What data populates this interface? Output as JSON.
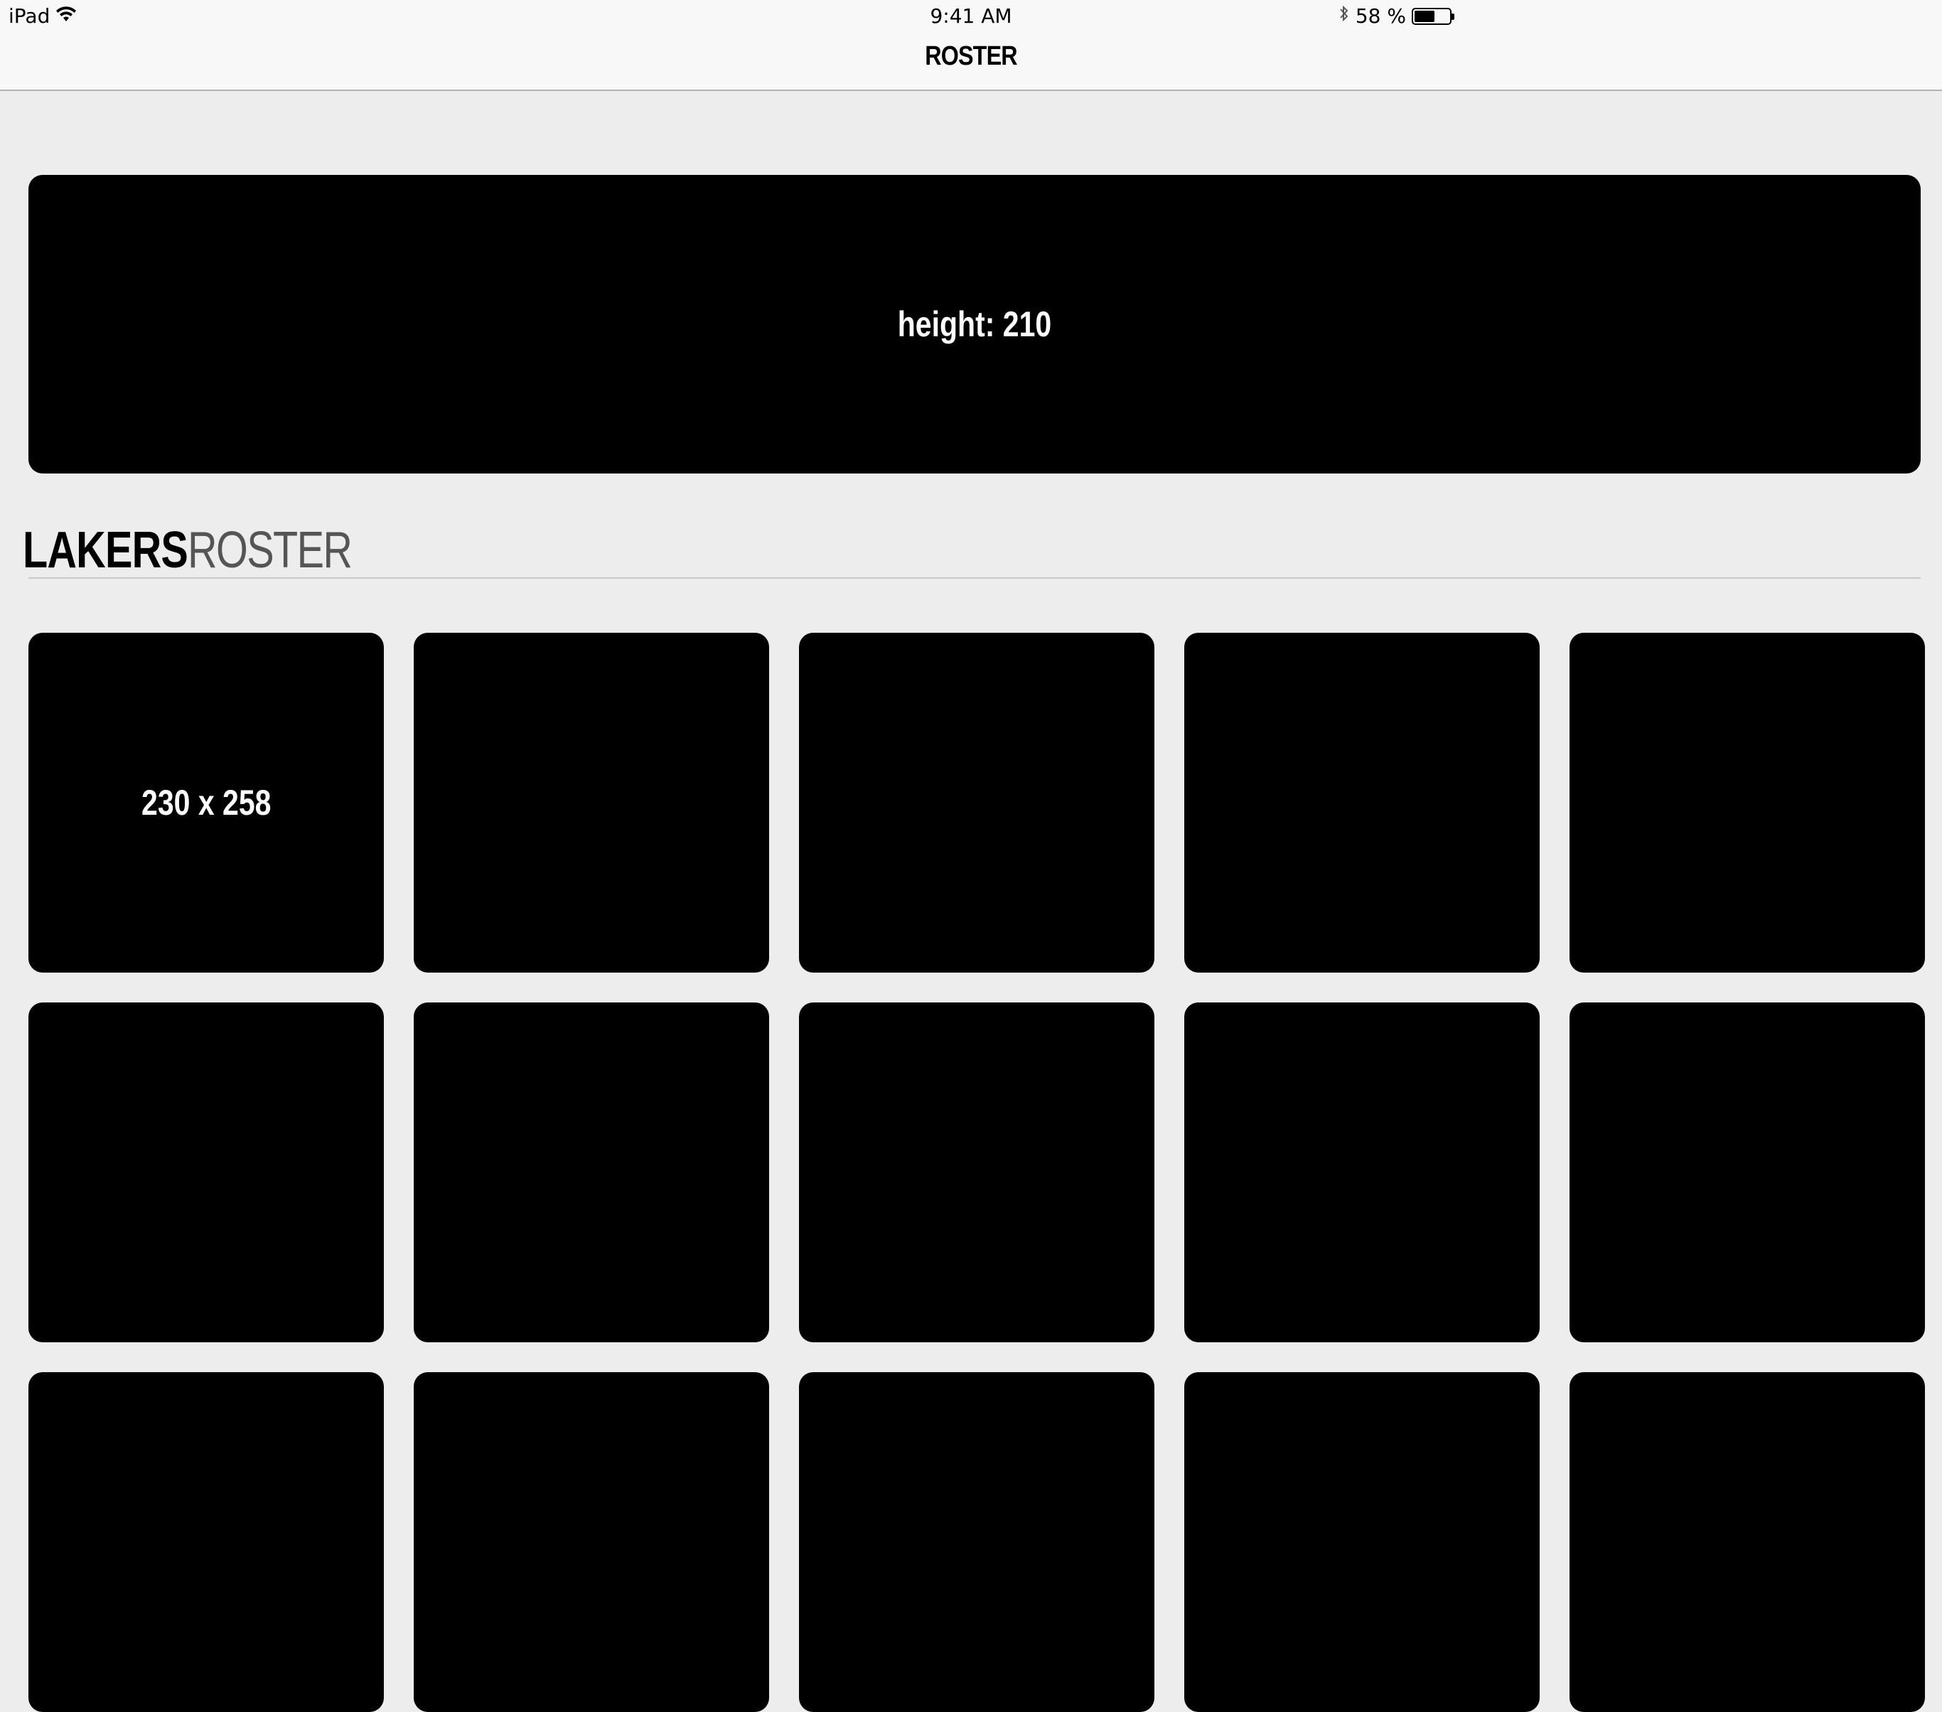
{
  "status_bar": {
    "device": "iPad",
    "time": "9:41 AM",
    "battery_text": "58 %",
    "battery_level": 0.58,
    "icons": [
      "wifi-icon",
      "bluetooth-icon",
      "battery-icon"
    ]
  },
  "nav": {
    "title": "ROSTER"
  },
  "banner": {
    "text": "height: 210"
  },
  "section": {
    "title_bold": "LAKERS",
    "title_light": "ROSTER"
  },
  "grid": {
    "tiles": [
      {
        "label": "230 x 258"
      },
      {
        "label": ""
      },
      {
        "label": ""
      },
      {
        "label": ""
      },
      {
        "label": ""
      },
      {
        "label": ""
      },
      {
        "label": ""
      },
      {
        "label": ""
      },
      {
        "label": ""
      },
      {
        "label": ""
      },
      {
        "label": ""
      },
      {
        "label": ""
      },
      {
        "label": ""
      },
      {
        "label": ""
      },
      {
        "label": ""
      }
    ]
  },
  "colors": {
    "background": "#ededed",
    "bar_background": "#f8f8f8",
    "tile": "#000000",
    "tile_text": "#ffffff"
  }
}
